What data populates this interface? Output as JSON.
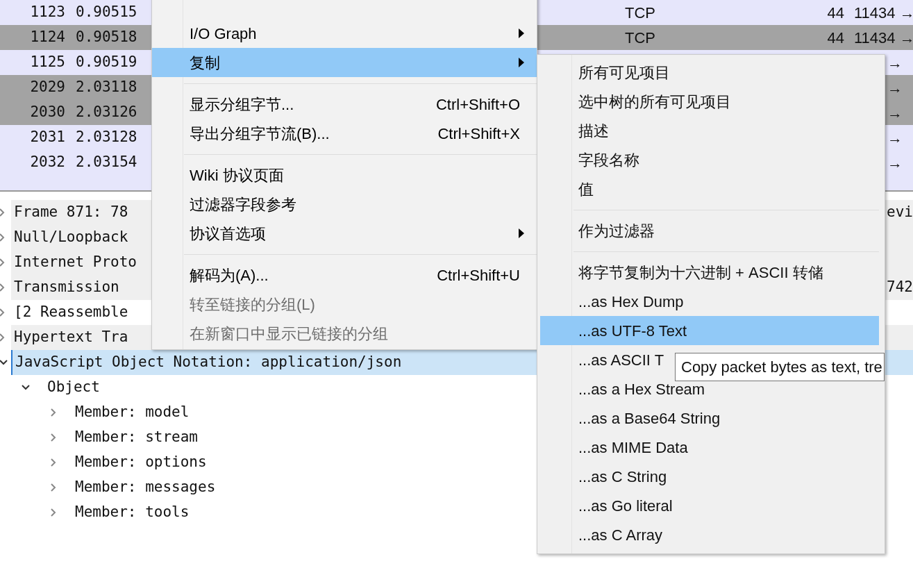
{
  "packet_list": {
    "rows": [
      {
        "no": "1123",
        "time": "0.90515",
        "protocol": "TCP",
        "length": "44",
        "info": "11434 →",
        "shaded": false
      },
      {
        "no": "1124",
        "time": "0.90518",
        "protocol": "TCP",
        "length": "44",
        "info": "11434 →",
        "shaded": true
      },
      {
        "no": "1125",
        "time": "0.90519",
        "info": "→",
        "shaded": false
      },
      {
        "no": "2029",
        "time": "2.03118",
        "info": "→",
        "shaded": true
      },
      {
        "no": "2030",
        "time": "2.03126",
        "info": "→",
        "shaded": true
      },
      {
        "no": "2031",
        "time": "2.03128",
        "info": "→",
        "shaded": false
      },
      {
        "no": "2032",
        "time": "2.03154",
        "info": "→",
        "shaded": false
      }
    ]
  },
  "packet_details": {
    "rows": [
      {
        "label": "Frame 871: 78",
        "trailing": "evi",
        "shaded": true,
        "selected": false,
        "expanded": false
      },
      {
        "label": "Null/Loopback",
        "shaded": true,
        "selected": false,
        "expanded": false
      },
      {
        "label": "Internet Proto",
        "shaded": true,
        "selected": false,
        "expanded": false
      },
      {
        "label": "Transmission",
        "trailing": "742",
        "shaded": true,
        "selected": false,
        "expanded": false
      },
      {
        "label": "[2 Reassemble",
        "shaded": false,
        "selected": false,
        "expanded": false
      },
      {
        "label": "Hypertext Tra",
        "shaded": true,
        "selected": false,
        "expanded": false
      },
      {
        "label": "JavaScript Object Notation: application/json",
        "selected": true,
        "expanded": true,
        "children": [
          {
            "label": "Object",
            "expanded": true,
            "selected": false,
            "children": [
              {
                "label": "Member: model",
                "expanded": false,
                "selected": false
              },
              {
                "label": "Member: stream",
                "expanded": false,
                "selected": false
              },
              {
                "label": "Member: options",
                "expanded": false,
                "selected": false
              },
              {
                "label": "Member: messages",
                "expanded": false,
                "selected": false
              },
              {
                "label": "Member: tools",
                "expanded": false,
                "selected": false
              }
            ]
          }
        ]
      }
    ]
  },
  "context_menu": {
    "items": [
      {
        "kind": "item",
        "label": "I/O Graph",
        "submenu": true,
        "disabled": false,
        "selected": false
      },
      {
        "kind": "item",
        "label": "复制",
        "submenu": true,
        "disabled": false,
        "selected": true
      },
      {
        "kind": "separator"
      },
      {
        "kind": "item",
        "label": "显示分组字节...",
        "shortcut": "Ctrl+Shift+O",
        "submenu": false,
        "disabled": false,
        "selected": false
      },
      {
        "kind": "item",
        "label": "导出分组字节流(B)...",
        "shortcut": "Ctrl+Shift+X",
        "submenu": false,
        "disabled": false,
        "selected": false
      },
      {
        "kind": "separator"
      },
      {
        "kind": "item",
        "label": "Wiki 协议页面",
        "submenu": false,
        "disabled": false,
        "selected": false
      },
      {
        "kind": "item",
        "label": "过滤器字段参考",
        "submenu": false,
        "disabled": false,
        "selected": false
      },
      {
        "kind": "item",
        "label": "协议首选项",
        "submenu": true,
        "disabled": false,
        "selected": false
      },
      {
        "kind": "separator"
      },
      {
        "kind": "item",
        "label": "解码为(A)...",
        "shortcut": "Ctrl+Shift+U",
        "submenu": false,
        "disabled": false,
        "selected": false
      },
      {
        "kind": "item",
        "label": "转至链接的分组(L)",
        "submenu": false,
        "disabled": true,
        "selected": false
      },
      {
        "kind": "item",
        "label": "在新窗口中显示已链接的分组",
        "submenu": false,
        "disabled": true,
        "selected": false
      }
    ]
  },
  "copy_submenu": {
    "items": [
      {
        "kind": "item",
        "label": "所有可见项目",
        "selected": false
      },
      {
        "kind": "item",
        "label": "选中树的所有可见项目",
        "selected": false
      },
      {
        "kind": "item",
        "label": "描述",
        "selected": false
      },
      {
        "kind": "item",
        "label": "字段名称",
        "selected": false
      },
      {
        "kind": "item",
        "label": "值",
        "selected": false
      },
      {
        "kind": "separator"
      },
      {
        "kind": "item",
        "label": "作为过滤器",
        "selected": false
      },
      {
        "kind": "separator"
      },
      {
        "kind": "item",
        "label": "将字节复制为十六进制 + ASCII 转储",
        "selected": false
      },
      {
        "kind": "item",
        "label": "...as Hex Dump",
        "selected": false
      },
      {
        "kind": "item",
        "label": "...as UTF-8 Text",
        "selected": true
      },
      {
        "kind": "item",
        "label": "...as ASCII T",
        "selected": false
      },
      {
        "kind": "item",
        "label": "...as a Hex Stream",
        "selected": false
      },
      {
        "kind": "item",
        "label": "...as a Base64 String",
        "selected": false
      },
      {
        "kind": "item",
        "label": "...as MIME Data",
        "selected": false
      },
      {
        "kind": "item",
        "label": "...as C String",
        "selected": false
      },
      {
        "kind": "item",
        "label": "...as Go literal",
        "selected": false
      },
      {
        "kind": "item",
        "label": "...as C Array",
        "selected": false
      }
    ]
  },
  "tooltip": {
    "text": "Copy packet bytes as text, tre"
  }
}
